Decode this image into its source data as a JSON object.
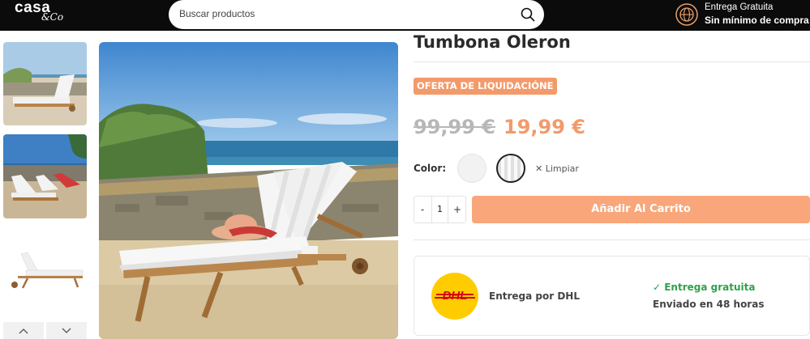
{
  "header": {
    "logo_main": "casa",
    "logo_sub": "&Co",
    "search_placeholder": "Buscar productos",
    "delivery_line1": "Entrega Gratuita",
    "delivery_line2": "Sin mínimo de compra"
  },
  "product": {
    "title": "Tumbona Oleron",
    "badge": "OFERTA DE LIQUIDACIÓNE",
    "old_price": "99,99 €",
    "new_price": "19,99 €",
    "color_label": "Color:",
    "clear_label": "✕ Limpiar",
    "quantity": "1",
    "qty_minus": "-",
    "qty_plus": "+",
    "add_to_cart": "Añadir Al Carrito"
  },
  "shipping": {
    "carrier_label": "Entrega por DHL",
    "free_label": "✓ Entrega gratuita",
    "time_label": "Enviado en 48 horas"
  },
  "colors": {
    "accent": "#f39a6b",
    "button": "#f8a67a",
    "green": "#2fa14a",
    "dhl_yellow": "#ffcc00",
    "dhl_red": "#d40511"
  }
}
